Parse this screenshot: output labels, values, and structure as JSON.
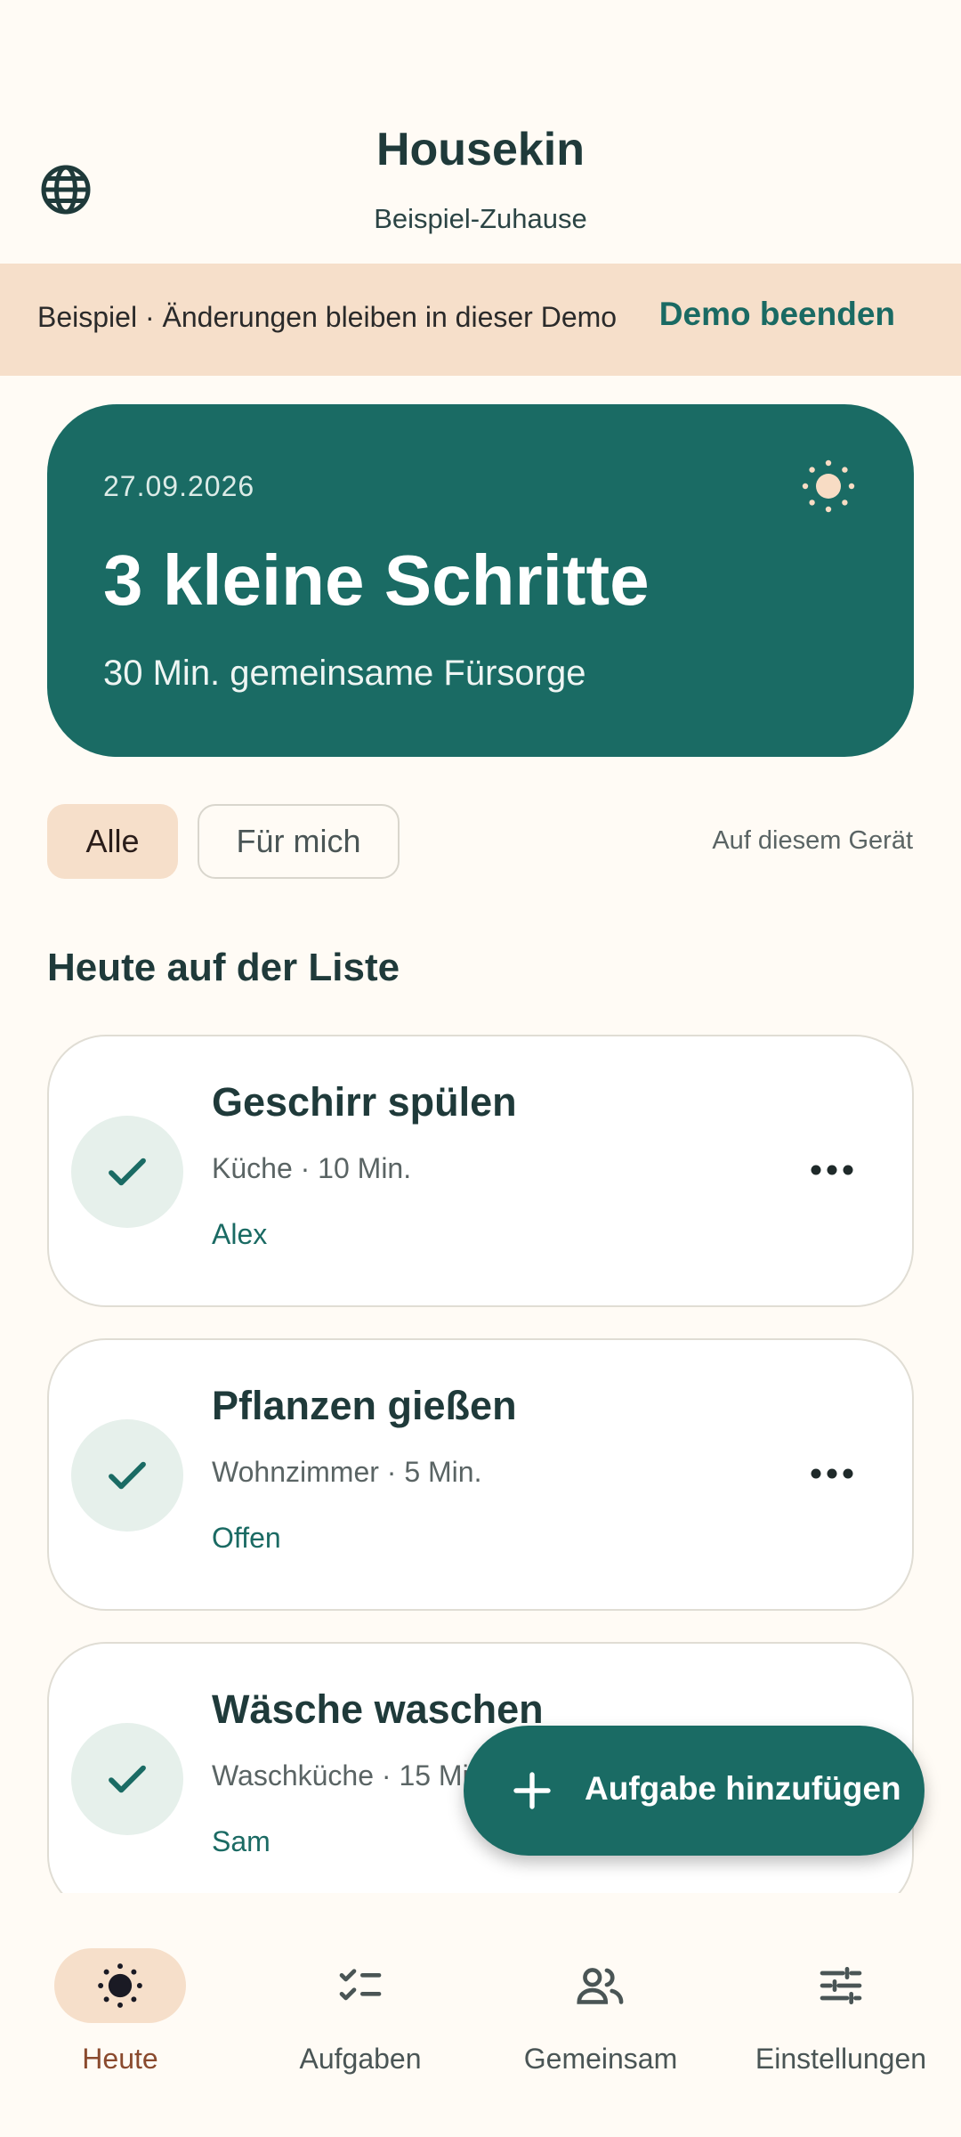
{
  "header": {
    "app_title": "Housekin",
    "subtitle": "Beispiel-Zuhause",
    "language_icon": "globe-icon"
  },
  "banner": {
    "text": "Beispiel · Änderungen bleiben in dieser Demo",
    "action": "Demo beenden"
  },
  "hero": {
    "date": "27.09.2026",
    "title": "3 kleine Schritte",
    "subtitle": "30 Min. gemeinsame Fürsorge",
    "icon": "sun-icon"
  },
  "filters": {
    "items": [
      {
        "label": "Alle",
        "selected": true
      },
      {
        "label": "Für mich",
        "selected": false
      }
    ],
    "scope_note": "Auf diesem Gerät"
  },
  "section": {
    "title": "Heute auf der Liste"
  },
  "tasks": [
    {
      "title": "Geschirr spülen",
      "meta": "Küche · 10 Min.",
      "assignee": "Alex"
    },
    {
      "title": "Pflanzen gießen",
      "meta": "Wohnzimmer · 5 Min.",
      "assignee": "Offen"
    },
    {
      "title": "Wäsche waschen",
      "meta": "Waschküche · 15 Min.",
      "assignee": "Sam"
    }
  ],
  "fab": {
    "label": "Aufgabe hinzufügen",
    "icon": "plus-icon"
  },
  "nav": {
    "items": [
      {
        "label": "Heute",
        "icon": "sun-icon",
        "active": true
      },
      {
        "label": "Aufgaben",
        "icon": "checklist-icon",
        "active": false
      },
      {
        "label": "Gemeinsam",
        "icon": "people-icon",
        "active": false
      },
      {
        "label": "Einstellungen",
        "icon": "sliders-icon",
        "active": false
      }
    ]
  },
  "colors": {
    "background": "#fffbf5",
    "primary": "#1a6b64",
    "accent_soft": "#f6dfca",
    "text": "#1f3a3a"
  }
}
